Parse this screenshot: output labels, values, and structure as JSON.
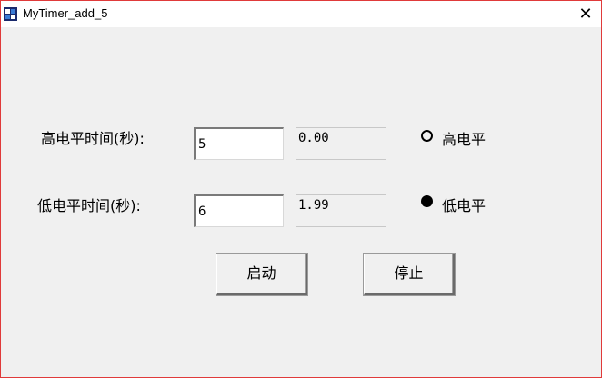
{
  "window": {
    "title": "MyTimer_add_5",
    "close_glyph": "✕"
  },
  "rows": [
    {
      "label": "高电平时间(秒):",
      "input_value": "5",
      "readout": "0.00",
      "radio_label": "高电平",
      "radio_selected": false
    },
    {
      "label": "低电平时间(秒):",
      "input_value": "6",
      "readout": "1.99",
      "radio_label": "低电平",
      "radio_selected": true
    }
  ],
  "buttons": {
    "start_label": "启动",
    "stop_label": "停止"
  },
  "icons": {
    "app": "app-icon",
    "close": "close-icon"
  }
}
